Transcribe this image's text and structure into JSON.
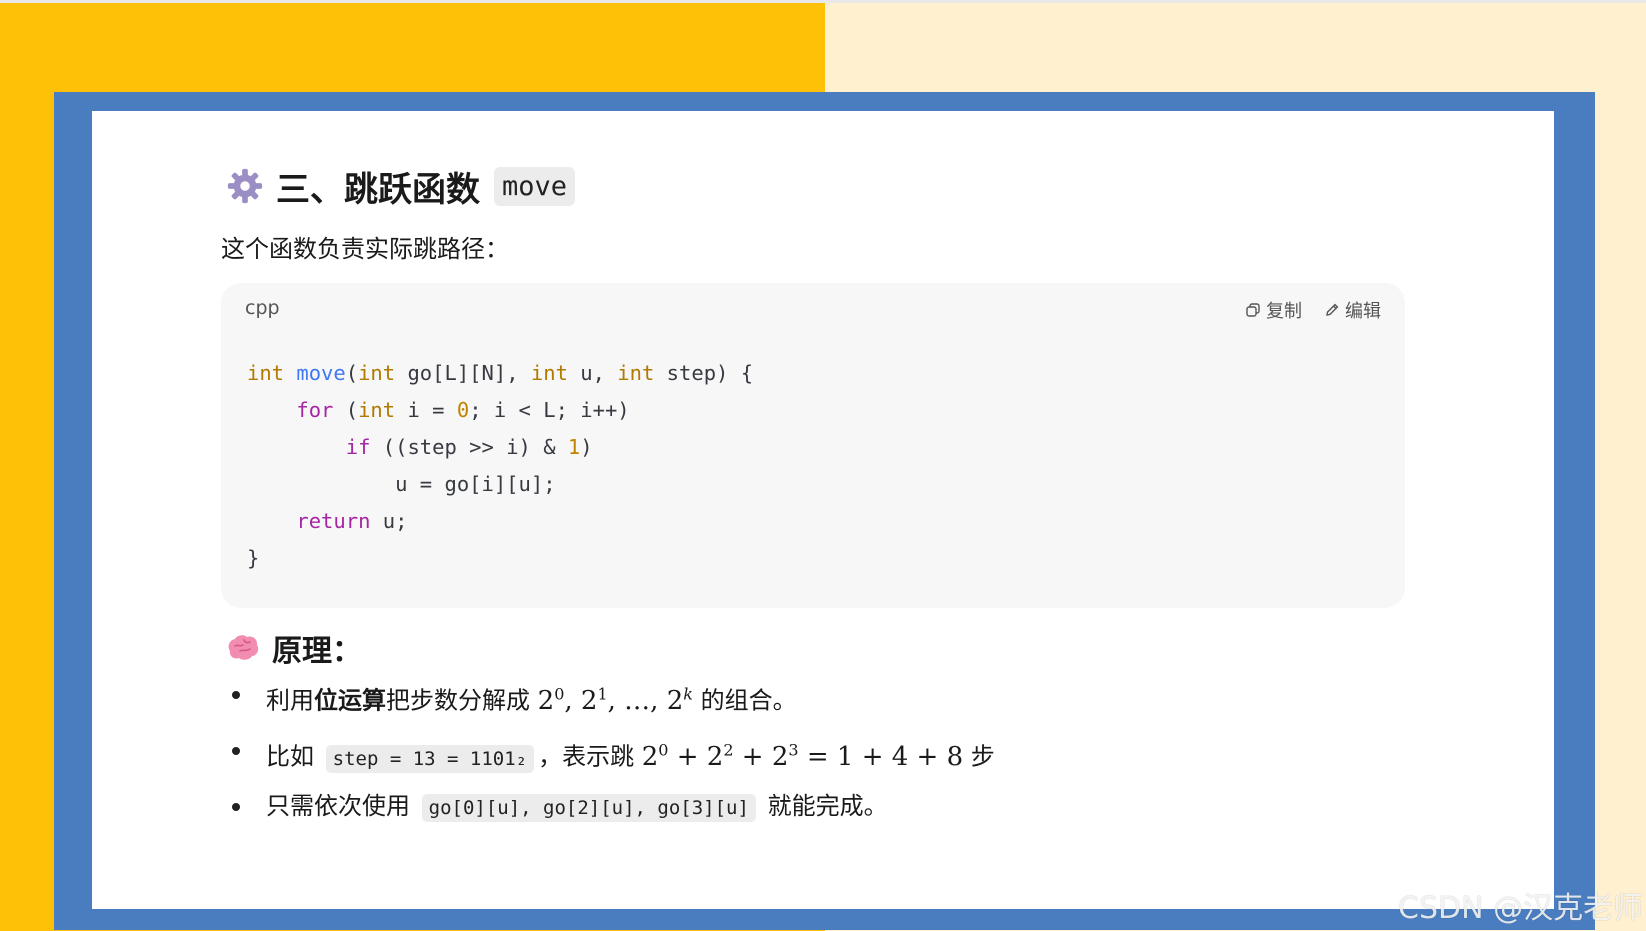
{
  "heading": {
    "title": "三、跳跃函数",
    "code": "move"
  },
  "intro": "这个函数负责实际跳路径：",
  "codeblock": {
    "lang": "cpp",
    "copy_label": "复制",
    "edit_label": "编辑",
    "lines": [
      [
        {
          "t": "int",
          "c": "ty"
        },
        {
          "t": " "
        },
        {
          "t": "move",
          "c": "fn"
        },
        {
          "t": "("
        },
        {
          "t": "int",
          "c": "ty"
        },
        {
          "t": " go[L][N], "
        },
        {
          "t": "int",
          "c": "ty"
        },
        {
          "t": " u, "
        },
        {
          "t": "int",
          "c": "ty"
        },
        {
          "t": " step) {"
        }
      ],
      [
        {
          "t": "    "
        },
        {
          "t": "for",
          "c": "kw"
        },
        {
          "t": " ("
        },
        {
          "t": "int",
          "c": "ty"
        },
        {
          "t": " i = "
        },
        {
          "t": "0",
          "c": "num"
        },
        {
          "t": "; i < L; i++)"
        }
      ],
      [
        {
          "t": "        "
        },
        {
          "t": "if",
          "c": "kw"
        },
        {
          "t": " ((step >> i) & "
        },
        {
          "t": "1",
          "c": "num"
        },
        {
          "t": ")"
        }
      ],
      [
        {
          "t": "            u = go[i][u];"
        }
      ],
      [
        {
          "t": "    "
        },
        {
          "t": "return",
          "c": "kw"
        },
        {
          "t": " u;"
        }
      ],
      [
        {
          "t": "}"
        }
      ]
    ]
  },
  "principle": {
    "title": "原理：",
    "b1": {
      "pre": "利用",
      "bold": "位运算",
      "mid": "把步数分解成 ",
      "post": " 的组合。"
    },
    "b2": {
      "pre": "比如 ",
      "code": "step = 13 = 1101₂",
      "mid": "，表示跳 ",
      "post": " 步"
    },
    "b3": {
      "pre": "只需依次使用 ",
      "code": "go[0][u], go[2][u], go[3][u]",
      "post": " 就能完成。"
    }
  },
  "watermark": "CSDN @汉克老师"
}
